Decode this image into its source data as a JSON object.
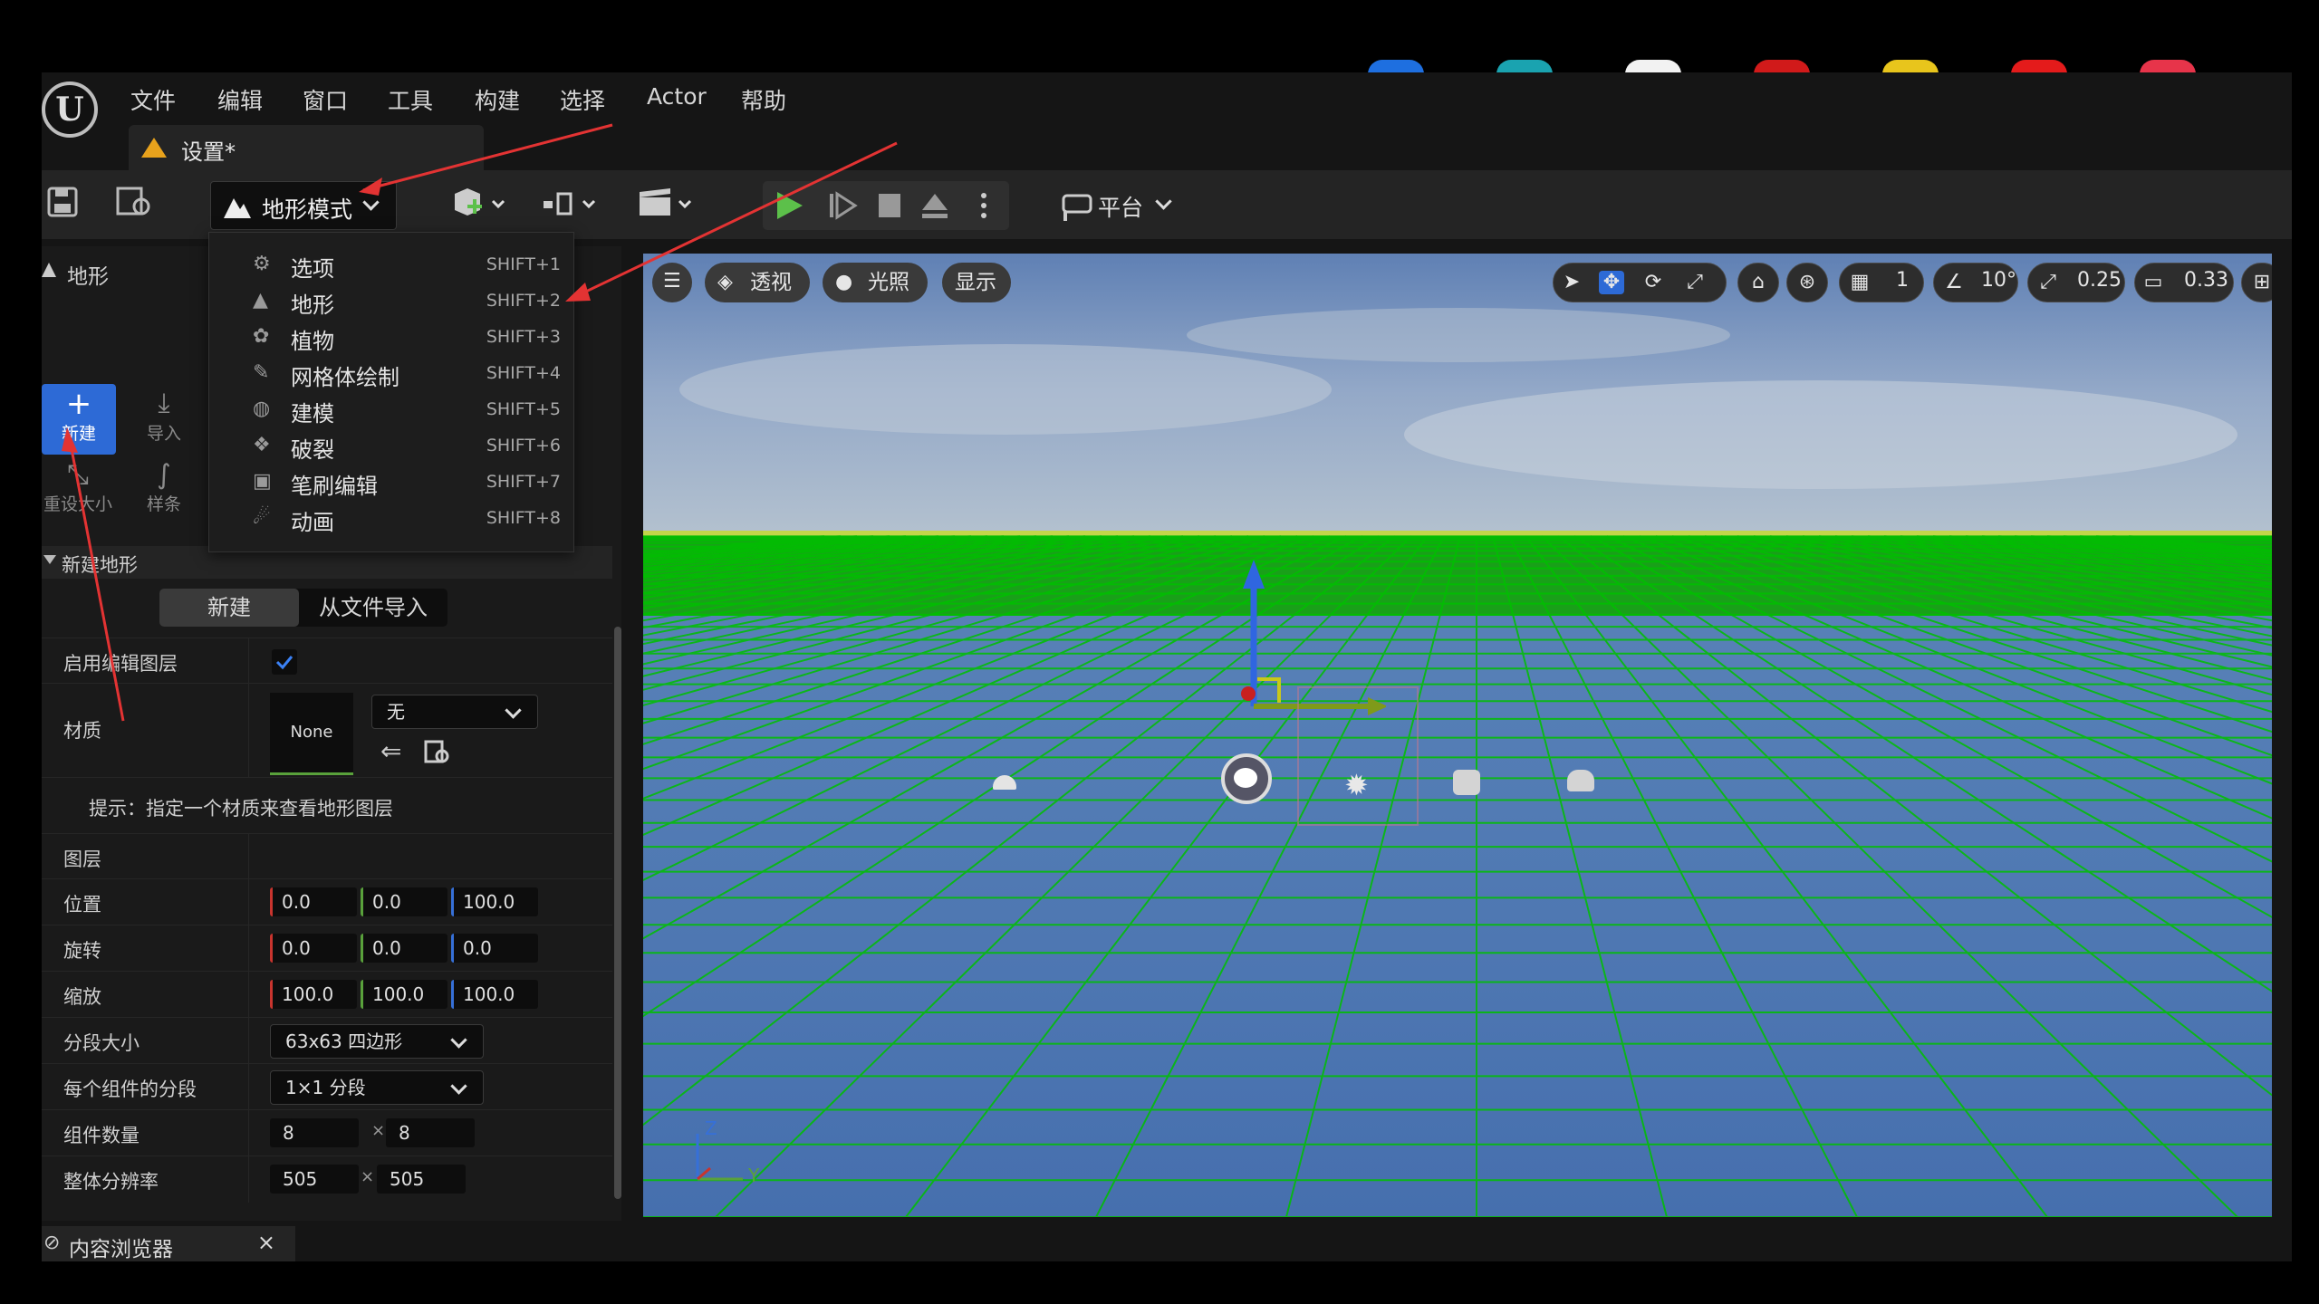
{
  "menubar": {
    "items": [
      "文件",
      "编辑",
      "窗口",
      "工具",
      "构建",
      "选择",
      "Actor",
      "帮助"
    ]
  },
  "doc_tab": {
    "label": "设置*"
  },
  "toolbar": {
    "mode_label": "地形模式",
    "platform_label": "平台"
  },
  "mode_menu": {
    "items": [
      {
        "label": "选项",
        "shortcut": "SHIFT+1",
        "icon": "gear-icon"
      },
      {
        "label": "地形",
        "shortcut": "SHIFT+2",
        "icon": "mountain-icon"
      },
      {
        "label": "植物",
        "shortcut": "SHIFT+3",
        "icon": "plant-icon"
      },
      {
        "label": "网格体绘制",
        "shortcut": "SHIFT+4",
        "icon": "brush-icon"
      },
      {
        "label": "建模",
        "shortcut": "SHIFT+5",
        "icon": "modeling-icon"
      },
      {
        "label": "破裂",
        "shortcut": "SHIFT+6",
        "icon": "fracture-icon"
      },
      {
        "label": "笔刷编辑",
        "shortcut": "SHIFT+7",
        "icon": "brush-edit-icon"
      },
      {
        "label": "动画",
        "shortcut": "SHIFT+8",
        "icon": "animation-icon"
      }
    ]
  },
  "left_panel": {
    "title": "地形",
    "tools": {
      "new": "新建",
      "import": "导入",
      "resize": "重设大小",
      "spline": "样条"
    },
    "section_title": "新建地形",
    "segments": {
      "new": "新建",
      "import_file": "从文件导入"
    },
    "rows": {
      "enable_layers": "启用编辑图层",
      "material": "材质",
      "material_thumb": "None",
      "material_combo": "无",
      "hint": "提示：指定一个材质来查看地形图层",
      "layers": "图层",
      "location": "位置",
      "location_values": [
        "0.0",
        "0.0",
        "100.0"
      ],
      "rotation": "旋转",
      "rotation_values": [
        "0.0",
        "0.0",
        "0.0"
      ],
      "scale": "缩放",
      "scale_values": [
        "100.0",
        "100.0",
        "100.0"
      ],
      "section_size": "分段大小",
      "section_size_value": "63x63 四边形",
      "sections_per_component": "每个组件的分段",
      "sections_per_component_value": "1×1 分段",
      "component_count": "组件数量",
      "component_count_values": [
        "8",
        "8"
      ],
      "overall_resolution": "整体分辨率",
      "overall_resolution_values": [
        "505",
        "505"
      ],
      "times_sign": "×"
    }
  },
  "viewport": {
    "perspective": "透视",
    "lit": "光照",
    "show": "显示",
    "grid_value": "1",
    "angle_value": "10°",
    "scale_value": "0.25",
    "camera_value": "0.33",
    "axis_z": "Z",
    "axis_y": "Y"
  },
  "bottom": {
    "content_browser": "内容浏览器",
    "close": "×"
  },
  "colors": {
    "accent": "#2d6ad6",
    "annotation": "#e33333",
    "ground_grid": "#00a000"
  }
}
